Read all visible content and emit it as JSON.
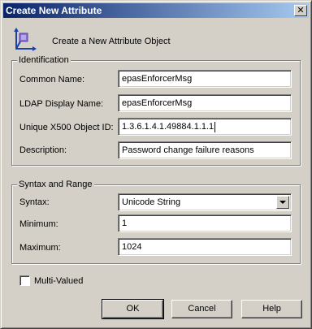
{
  "window": {
    "title": "Create New Attribute",
    "close_glyph": "✕"
  },
  "header": {
    "icon": "attribute-object-icon",
    "text": "Create a New Attribute Object"
  },
  "identification": {
    "legend": "Identification",
    "common_name": {
      "label": "Common Name:",
      "value": "epasEnforcerMsg"
    },
    "ldap_display_name": {
      "label": "LDAP Display Name:",
      "value": "epasEnforcerMsg"
    },
    "x500_oid": {
      "label": "Unique X500 Object ID:",
      "value": "1.3.6.1.4.1.49884.1.1.1"
    },
    "description": {
      "label": "Description:",
      "value": "Password change failure reasons"
    }
  },
  "syntax_range": {
    "legend": "Syntax and Range",
    "syntax": {
      "label": "Syntax:",
      "value": "Unicode String"
    },
    "minimum": {
      "label": "Minimum:",
      "value": "1"
    },
    "maximum": {
      "label": "Maximum:",
      "value": "1024"
    }
  },
  "multi_valued": {
    "label": "Multi-Valued",
    "checked": false
  },
  "buttons": {
    "ok": "OK",
    "cancel": "Cancel",
    "help": "Help"
  }
}
